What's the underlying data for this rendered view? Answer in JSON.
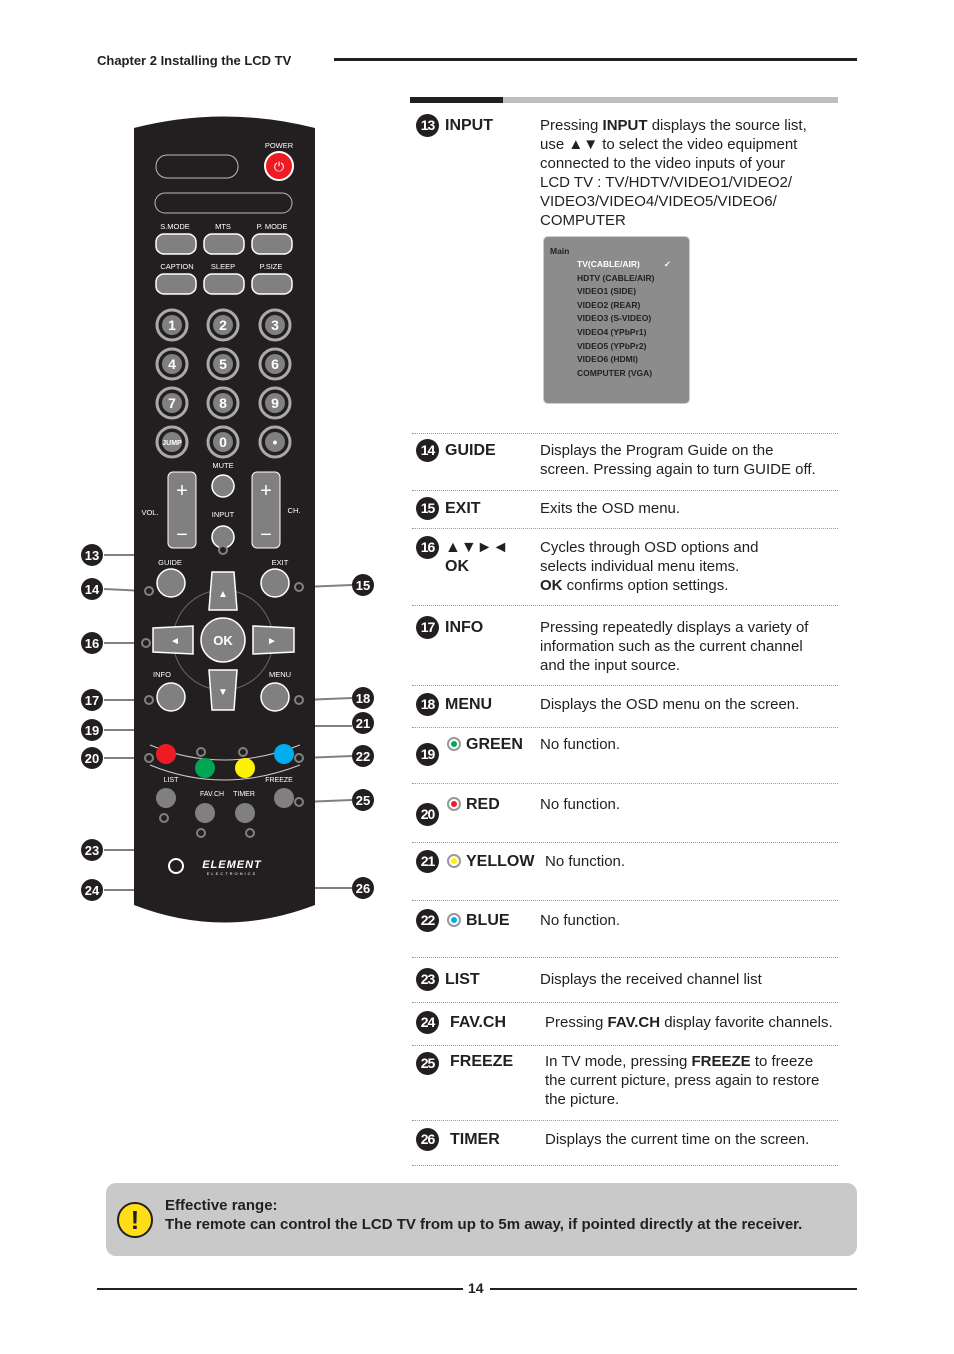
{
  "header": {
    "chapter": "Chapter 2 Installing the LCD TV"
  },
  "remote": {
    "labels": {
      "power": "POWER",
      "smode": "S.MODE",
      "mts": "MTS",
      "pmode": "P. MODE",
      "caption": "CAPTION",
      "sleep": "SLEEP",
      "psize": "P.SIZE",
      "jump": "JUMP",
      "mute": "MUTE",
      "vol": "VOL.",
      "ch": "CH.",
      "input": "INPUT",
      "guide": "GUIDE",
      "exit": "EXIT",
      "ok": "OK",
      "info": "INFO",
      "menu": "MENU",
      "list": "LIST",
      "favch": "FAV.CH",
      "timer": "TIMER",
      "freeze": "FREEZE",
      "dot": "•"
    },
    "digits": [
      "1",
      "2",
      "3",
      "4",
      "5",
      "6",
      "7",
      "8",
      "9",
      "0"
    ],
    "logo": "ELEMENT ELECTRONICS",
    "callouts": [
      "13",
      "14",
      "15",
      "16",
      "17",
      "18",
      "19",
      "20",
      "21",
      "22",
      "23",
      "24",
      "25",
      "26"
    ],
    "colors": {
      "red": "#ed1c24",
      "green": "#00a651",
      "yellow": "#fff200",
      "blue": "#00aeef",
      "power": "#ed1c24"
    }
  },
  "items": [
    {
      "num": "13",
      "title": "INPUT",
      "desc": [
        [
          {
            "t": "Pressing "
          },
          {
            "t": "INPUT",
            "b": true
          },
          {
            "t": " displays the source list,"
          }
        ],
        [
          {
            "t": "use ▲▼ to select the video equipment"
          }
        ],
        [
          {
            "t": "connected to the video inputs of your"
          }
        ],
        [
          {
            "t": "LCD TV : TV/HDTV/VIDEO1/VIDEO2/"
          }
        ],
        [
          {
            "t": "VIDEO3/VIDEO4/VIDEO5/VIDEO6/"
          }
        ],
        [
          {
            "t": "COMPUTER"
          }
        ]
      ]
    },
    {
      "num": "14",
      "title": "GUIDE",
      "desc": [
        [
          {
            "t": "Displays the Program Guide on the"
          }
        ],
        [
          {
            "t": "screen.  Pressing again to turn GUIDE off."
          }
        ]
      ]
    },
    {
      "num": "15",
      "title": "EXIT",
      "desc": [
        [
          {
            "t": "Exits the OSD menu."
          }
        ]
      ]
    },
    {
      "num": "16",
      "title": "▲▼►◄",
      "title2": "OK",
      "desc": [
        [
          {
            "t": "Cycles through OSD options and"
          }
        ],
        [
          {
            "t": "selects individual menu items."
          }
        ],
        [
          {
            "t": "OK",
            "b": true
          },
          {
            "t": " confirms option settings."
          }
        ]
      ]
    },
    {
      "num": "17",
      "title": "INFO",
      "desc": [
        [
          {
            "t": "Pressing repeatedly displays a variety of"
          }
        ],
        [
          {
            "t": "information such as the current channel"
          }
        ],
        [
          {
            "t": "and the input source."
          }
        ]
      ]
    },
    {
      "num": "18",
      "title": "MENU",
      "desc": [
        [
          {
            "t": "Displays the OSD menu on the screen."
          }
        ]
      ]
    },
    {
      "num": "19",
      "title": "GREEN",
      "dot": "#00a651",
      "desc": [
        [
          {
            "t": "No function."
          }
        ]
      ]
    },
    {
      "num": "20",
      "title": "RED",
      "dot": "#ed1c24",
      "desc": [
        [
          {
            "t": "No function."
          }
        ]
      ]
    },
    {
      "num": "21",
      "title": "YELLOW",
      "dot": "#fff200",
      "desc": [
        [
          {
            "t": "No function."
          }
        ]
      ]
    },
    {
      "num": "22",
      "title": "BLUE",
      "dot": "#00aeef",
      "desc": [
        [
          {
            "t": "No function."
          }
        ]
      ]
    },
    {
      "num": "23",
      "title": "LIST",
      "desc": [
        [
          {
            "t": "Displays the received channel list"
          }
        ]
      ]
    },
    {
      "num": "24",
      "title": "FAV.CH",
      "desc": [
        [
          {
            "t": "Pressing "
          },
          {
            "t": "FAV.CH",
            "b": true
          },
          {
            "t": " display favorite channels."
          }
        ]
      ]
    },
    {
      "num": "25",
      "title": "FREEZE",
      "desc": [
        [
          {
            "t": "In TV mode, pressing "
          },
          {
            "t": "FREEZE",
            "b": true
          },
          {
            "t": " to freeze"
          }
        ],
        [
          {
            "t": "the current picture, press again to restore"
          }
        ],
        [
          {
            "t": "the picture."
          }
        ]
      ]
    },
    {
      "num": "26",
      "title": "TIMER",
      "desc": [
        [
          {
            "t": "Displays the current time on the screen."
          }
        ]
      ]
    }
  ],
  "source_list": {
    "heading": "Main",
    "options": [
      "TV(CABLE/AIR)",
      "HDTV (CABLE/AIR)",
      "VIDEO1 (SIDE)",
      "VIDEO2 (REAR)",
      "VIDEO3 (S-VIDEO)",
      "VIDEO4 (YPbPr1)",
      "VIDEO5 (YPbPr2)",
      "VIDEO6 (HDMI)",
      "COMPUTER (VGA)"
    ],
    "selected": "TV(CABLE/AIR)",
    "check": "✓"
  },
  "notice": {
    "icon": "exclamation-icon",
    "mark": "!",
    "line1": "Effective range:",
    "line2": "The remote can control the LCD TV from up to 5m away, if pointed directly at the receiver."
  },
  "footer": {
    "page": "14"
  }
}
